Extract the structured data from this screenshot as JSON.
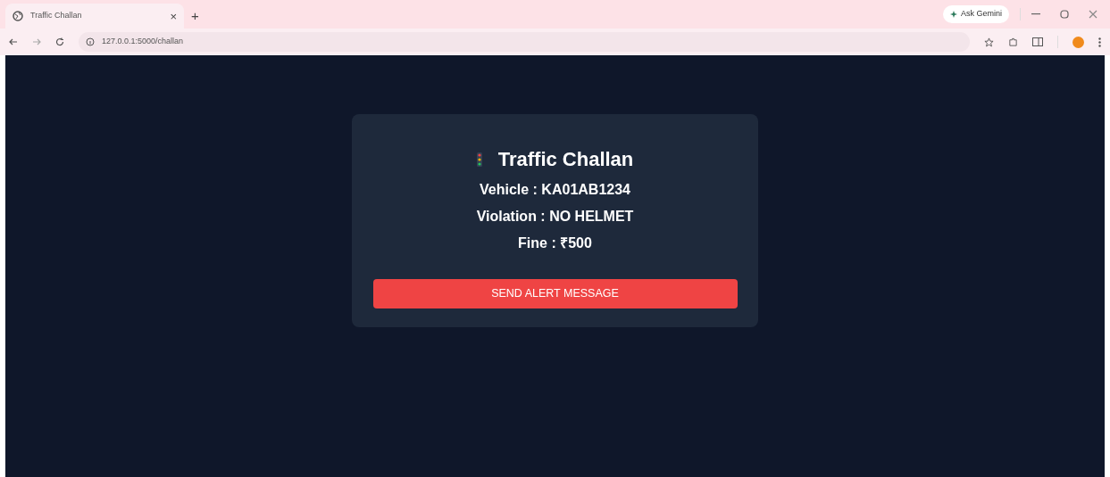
{
  "browser": {
    "tab": {
      "title": "Traffic Challan",
      "close": "×",
      "selected": true
    },
    "new_tab": "+",
    "ask_button": "Ask Gemini",
    "url": "127.0.0.1:5000/challan"
  },
  "card": {
    "title": "Traffic Challan",
    "lines": [
      "Vehicle : KA01AB1234",
      "Violation : NO HELMET",
      "Fine : ₹500"
    ],
    "button": "SEND ALERT MESSAGE"
  }
}
